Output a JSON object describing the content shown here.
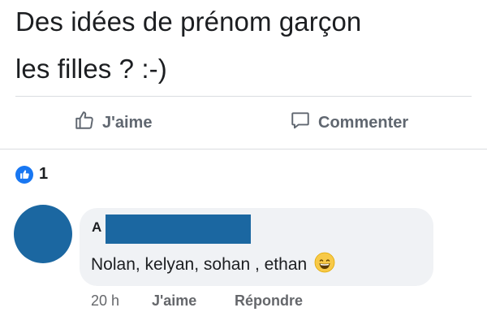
{
  "post": {
    "text_line1": "Des idées de prénom garçon",
    "text_line2": "les filles ? :-)"
  },
  "actions": {
    "like_label": "J'aime",
    "comment_label": "Commenter"
  },
  "reactions": {
    "count": "1",
    "icon": "thumbs-up-icon",
    "color": "#1877f2"
  },
  "comment": {
    "author_visible": "A",
    "author_redacted": true,
    "text": "Nolan, kelyan, sohan , ethan",
    "emoji": "grinning-face-with-smiling-eyes",
    "time": "20 h",
    "like_label": "J'aime",
    "reply_label": "Répondre",
    "avatar_color": "#1b67a1"
  }
}
